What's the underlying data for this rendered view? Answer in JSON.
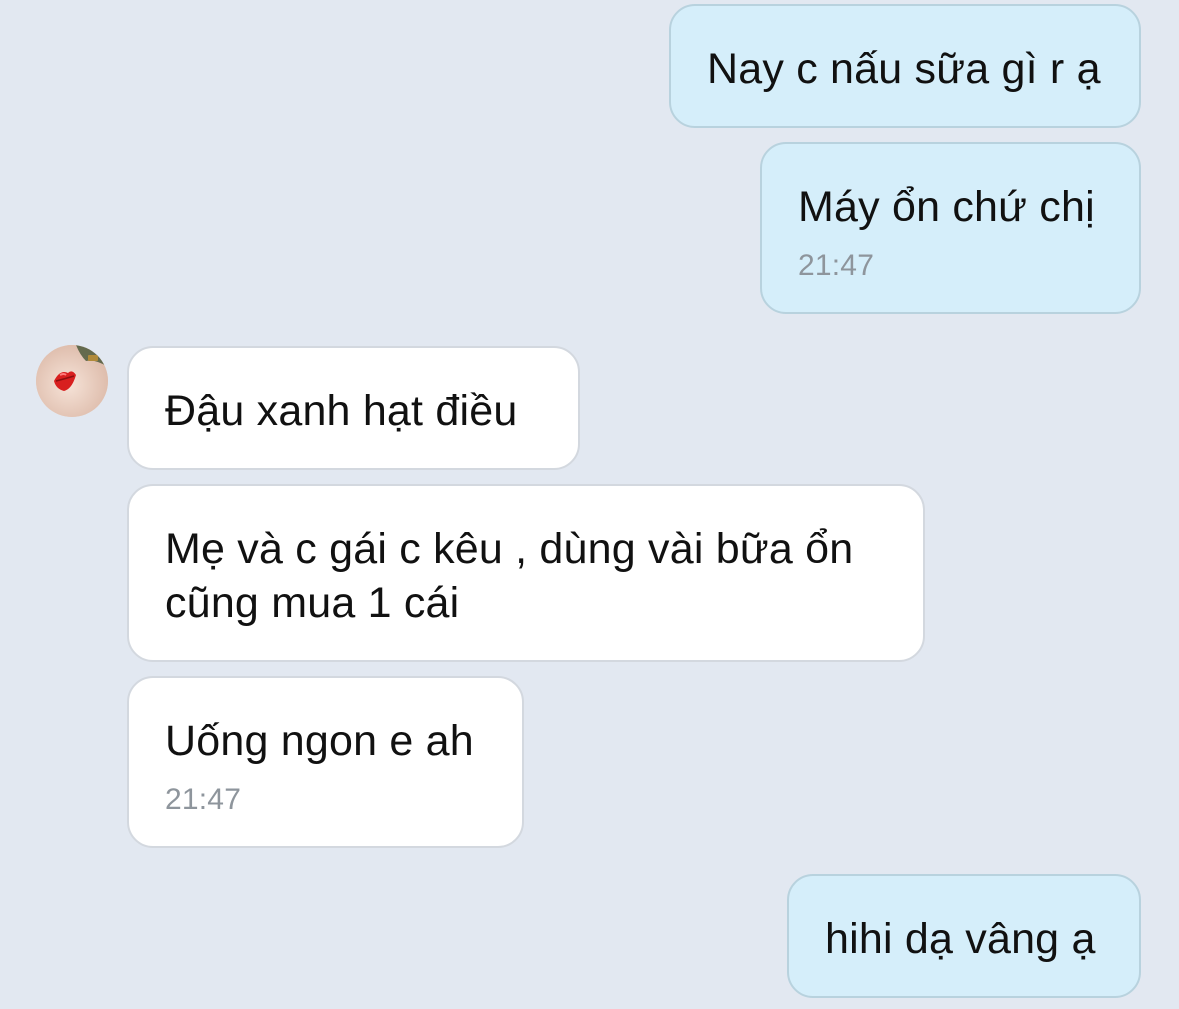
{
  "colors": {
    "background": "#e2e8f1",
    "outgoing_bubble": "#d5eefa",
    "incoming_bubble": "#ffffff",
    "timestamp": "#8e959c"
  },
  "avatar": {
    "icon": "user-avatar-lips"
  },
  "messages": [
    {
      "direction": "outgoing",
      "text": "Nay c nấu sữa gì r ạ"
    },
    {
      "direction": "outgoing",
      "text": "Máy ổn chứ chị",
      "time": "21:47"
    },
    {
      "direction": "incoming",
      "text": "Đậu xanh hạt điều"
    },
    {
      "direction": "incoming",
      "text": "Mẹ và c gái c kêu , dùng vài bữa ổn\ncũng mua 1 cái"
    },
    {
      "direction": "incoming",
      "text": "Uống ngon e ah",
      "time": "21:47"
    },
    {
      "direction": "outgoing",
      "text": "hihi dạ vâng ạ"
    }
  ]
}
